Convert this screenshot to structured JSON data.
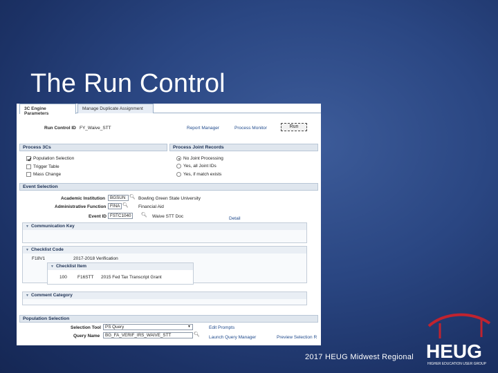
{
  "slide": {
    "title": "The Run Control",
    "footer": "2017 HEUG Midwest Regional"
  },
  "logo": {
    "text": "HEUG",
    "subtext": "HIGHER EDUCATION USER GROUP"
  },
  "app": {
    "tabs": [
      "3C Engine Parameters",
      "Manage Duplicate Assignment"
    ],
    "run_control_label": "Run Control ID",
    "run_control_value": "FY_Waive_STT",
    "report_manager": "Report Manager",
    "process_monitor": "Process Monitor",
    "run_button": "Run",
    "process_3cs": {
      "header": "Process 3Cs",
      "items": [
        "Population Selection",
        "Trigger Table",
        "Mass Change"
      ]
    },
    "process_joint": {
      "header": "Process Joint Records",
      "items": [
        "No Joint Processing",
        "Yes, all Joint IDs",
        "Yes, if match exists"
      ]
    },
    "event_selection": {
      "header": "Event Selection",
      "academic_institution_label": "Academic Institution",
      "academic_institution_value": "BGSUN",
      "academic_institution_desc": "Bowling Green State University",
      "admin_function_label": "Administrative Function",
      "admin_function_value": "FINA",
      "admin_function_desc": "Financial Aid",
      "event_id_label": "Event ID",
      "event_id_value": "FSTC1040",
      "event_id_desc": "Waive STT Doc",
      "detail_link": "Detail"
    },
    "communication_key": "Communication Key",
    "checklist_code": {
      "header": "Checklist Code",
      "code": "F18V1",
      "desc": "2017-2018 Verification"
    },
    "checklist_item": {
      "header": "Checklist Item",
      "seq": "100",
      "code": "F16STT",
      "desc": "2015 Fed Tax Transcript Grant"
    },
    "comment_category": "Comment Category",
    "population_selection": {
      "header": "Population Selection",
      "selection_tool_label": "Selection Tool",
      "selection_tool_value": "PS Query",
      "query_name_label": "Query Name",
      "query_name_value": "BG_FA_VERIF_IRS_WAIVE_STT",
      "edit_prompts": "Edit Prompts",
      "launch_query_manager": "Launch Query Manager",
      "preview_selection": "Preview Selection R"
    }
  }
}
